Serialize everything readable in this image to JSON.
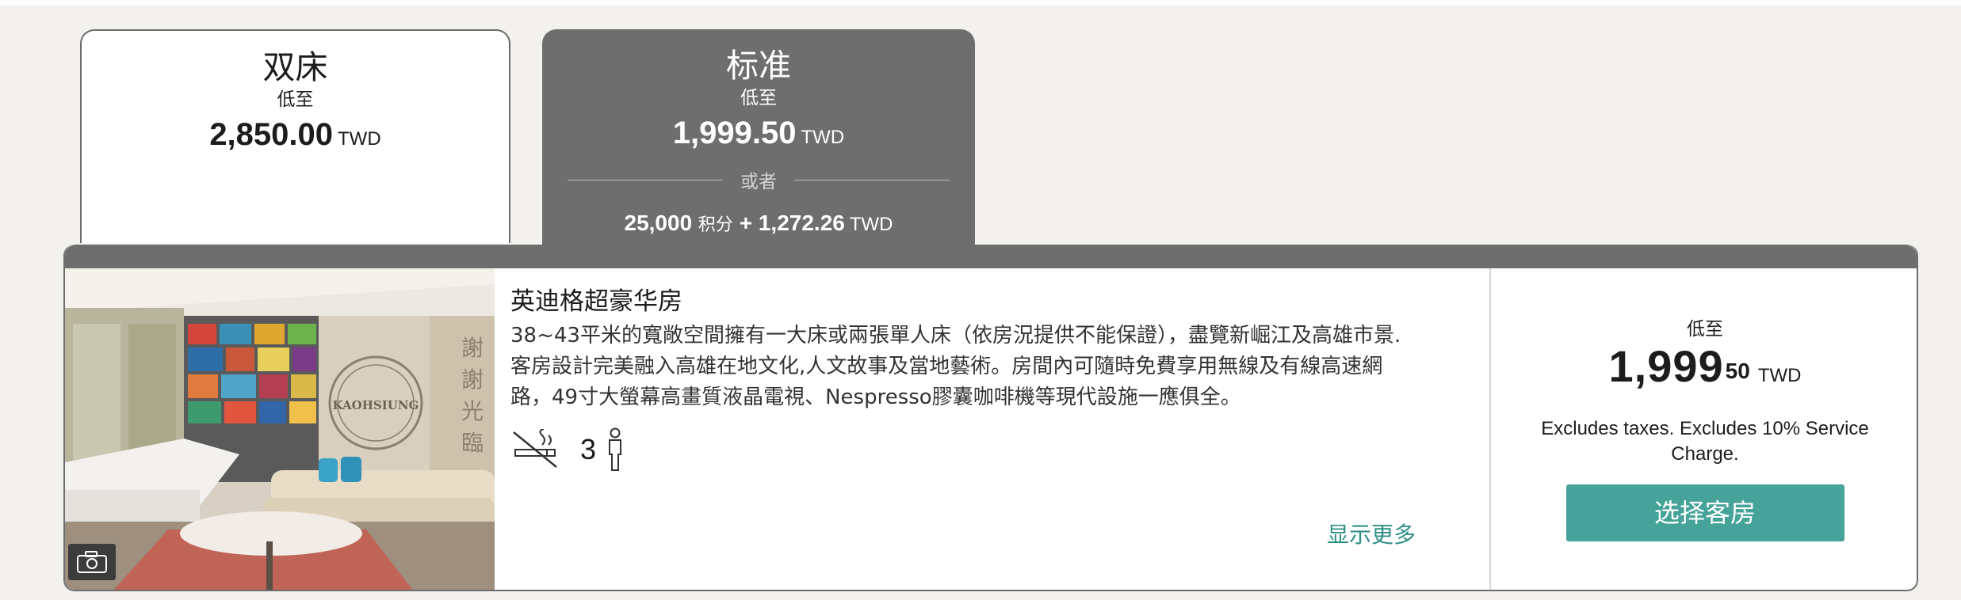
{
  "tabs": [
    {
      "title": "双床",
      "from_label": "低至",
      "price": "2,850.00",
      "currency": "TWD"
    },
    {
      "title": "标准",
      "from_label": "低至",
      "price": "1,999.50",
      "currency": "TWD",
      "or_label": "或者",
      "points": "25,000",
      "points_label": "积分",
      "points_plus_amount": "+ 1,272.26",
      "points_currency": "TWD"
    }
  ],
  "room": {
    "name": "英迪格超豪华房",
    "description_lines": [
      "38~43平米的寬敞空間擁有一大床或兩張單人床（依房況提供不能保證），盡覽新崛江及高雄市景.",
      "客房設計完美融入高雄在地文化,人文故事及當地藝術。房間內可隨時免費享用無線及有線高速網",
      "路，49寸大螢幕高畫質液晶電視、Nespresso膠囊咖啡機等現代設施一應俱全。"
    ],
    "max_occupancy": "3",
    "show_more": "显示更多",
    "photo_text": {
      "sign": "KAOHSIUNG",
      "wall_chars": [
        "謝",
        "謝",
        "光",
        "臨"
      ]
    }
  },
  "price_panel": {
    "from_label": "低至",
    "price_int": "1,999",
    "price_dec": "50",
    "currency": "TWD",
    "note": "Excludes taxes. Excludes 10% Service Charge.",
    "select_label": "选择客房"
  },
  "icons": [
    "no-smoking-icon",
    "person-icon",
    "camera-icon"
  ],
  "colors": {
    "accent": "#45a39a",
    "link": "#2e8f87",
    "tab_active": "#6e6e6e"
  }
}
